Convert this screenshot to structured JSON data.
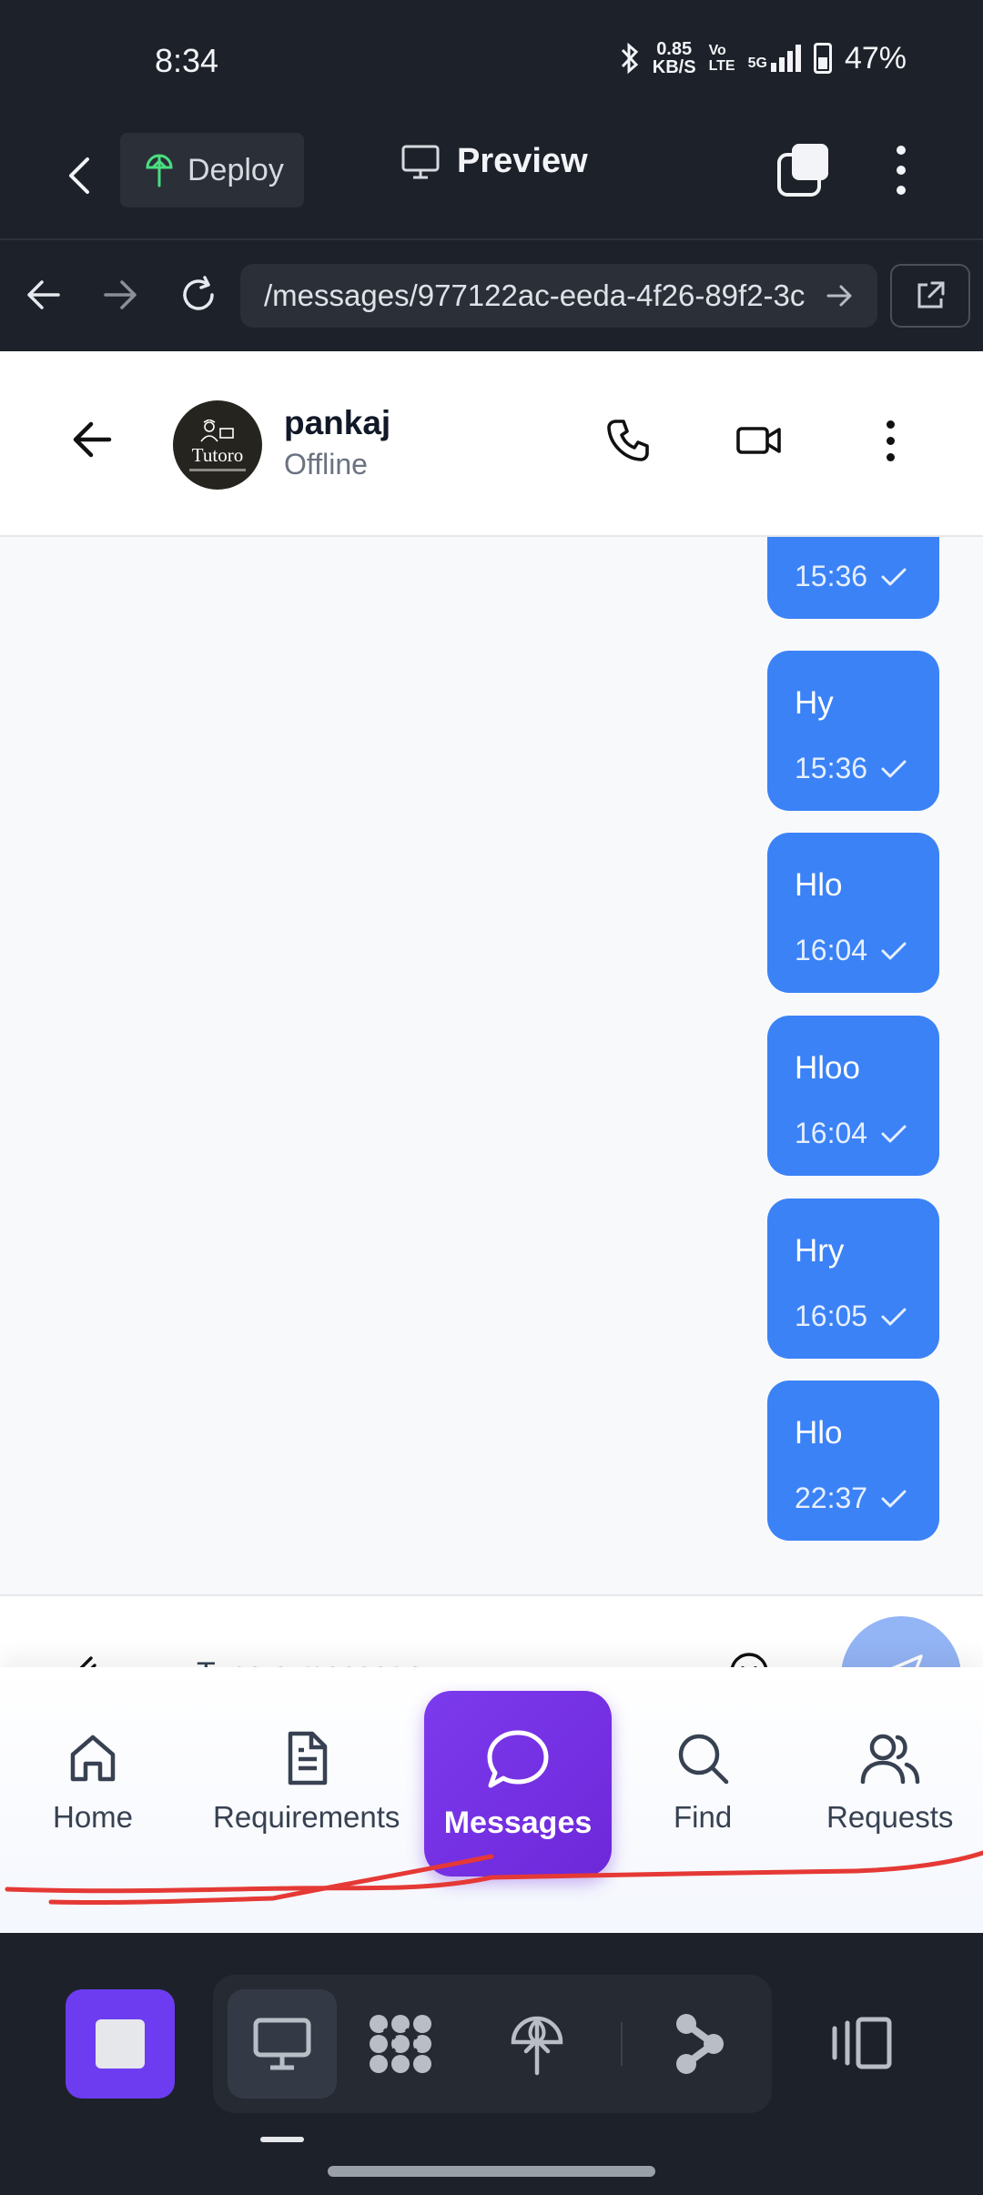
{
  "status_bar": {
    "time": "8:34",
    "net_speed_value": "0.85",
    "net_speed_unit": "KB/S",
    "volte_top": "Vo",
    "volte_bottom": "LTE",
    "network": "5G",
    "battery": "47%"
  },
  "app_bar": {
    "deploy_label": "Deploy",
    "preview_label": "Preview"
  },
  "browser": {
    "url": "/messages/977122ac-eeda-4f26-89f2-3c"
  },
  "chat": {
    "contact_name": "pankaj",
    "contact_status": "Offline",
    "avatar_brand": "Tutoro",
    "messages": [
      {
        "text": "",
        "time": "15:36"
      },
      {
        "text": "Hy",
        "time": "15:36"
      },
      {
        "text": "Hlo",
        "time": "16:04"
      },
      {
        "text": "Hloo",
        "time": "16:04"
      },
      {
        "text": "Hry",
        "time": "16:05"
      },
      {
        "text": "Hlo",
        "time": "22:37"
      }
    ],
    "composer_placeholder": "Type a message"
  },
  "bottom_nav": {
    "items": [
      {
        "label": "Home",
        "icon": "home-icon"
      },
      {
        "label": "Requirements",
        "icon": "document-icon"
      },
      {
        "label": "Messages",
        "icon": "chat-bubble-icon",
        "active": true
      },
      {
        "label": "Find",
        "icon": "search-icon"
      },
      {
        "label": "Requests",
        "icon": "users-icon"
      }
    ]
  },
  "colors": {
    "bubble": "#3b82f6",
    "active_nav": "#7c3aed",
    "dark_chrome": "#1d2129",
    "annotation_stroke": "#e53935"
  }
}
